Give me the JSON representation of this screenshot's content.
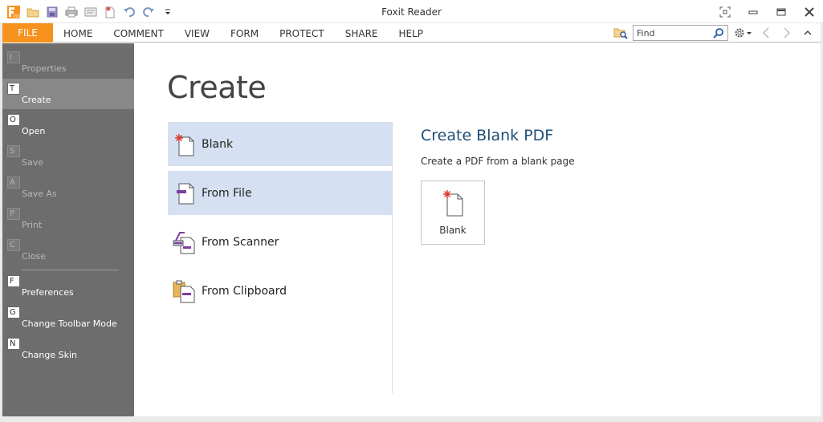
{
  "window": {
    "title": "Foxit Reader"
  },
  "ribbon": {
    "file_tab": "FILE",
    "tabs": [
      "HOME",
      "COMMENT",
      "VIEW",
      "FORM",
      "PROTECT",
      "SHARE",
      "HELP"
    ],
    "find_placeholder": "Find"
  },
  "sidebar": {
    "items": [
      {
        "key": "I",
        "label": "Properties"
      },
      {
        "key": "T",
        "label": "Create"
      },
      {
        "key": "O",
        "label": "Open"
      },
      {
        "key": "S",
        "label": "Save"
      },
      {
        "key": "A",
        "label": "Save As"
      },
      {
        "key": "P",
        "label": "Print"
      },
      {
        "key": "C",
        "label": "Close"
      },
      {
        "key": "F",
        "label": "Preferences"
      },
      {
        "key": "G",
        "label": "Change Toolbar Mode"
      },
      {
        "key": "N",
        "label": "Change Skin"
      }
    ]
  },
  "main": {
    "title": "Create",
    "options": [
      {
        "label": "Blank"
      },
      {
        "label": "From File"
      },
      {
        "label": "From Scanner"
      },
      {
        "label": "From Clipboard"
      }
    ],
    "detail": {
      "title": "Create Blank PDF",
      "description": "Create a PDF from a blank page",
      "button_label": "Blank"
    }
  },
  "colors": {
    "file_tab": "#f7921e",
    "sidebar_bg": "#6d6d6d",
    "sidebar_active": "#888888",
    "option_selected": "#d5e1f2",
    "detail_title": "#1f4e79"
  }
}
